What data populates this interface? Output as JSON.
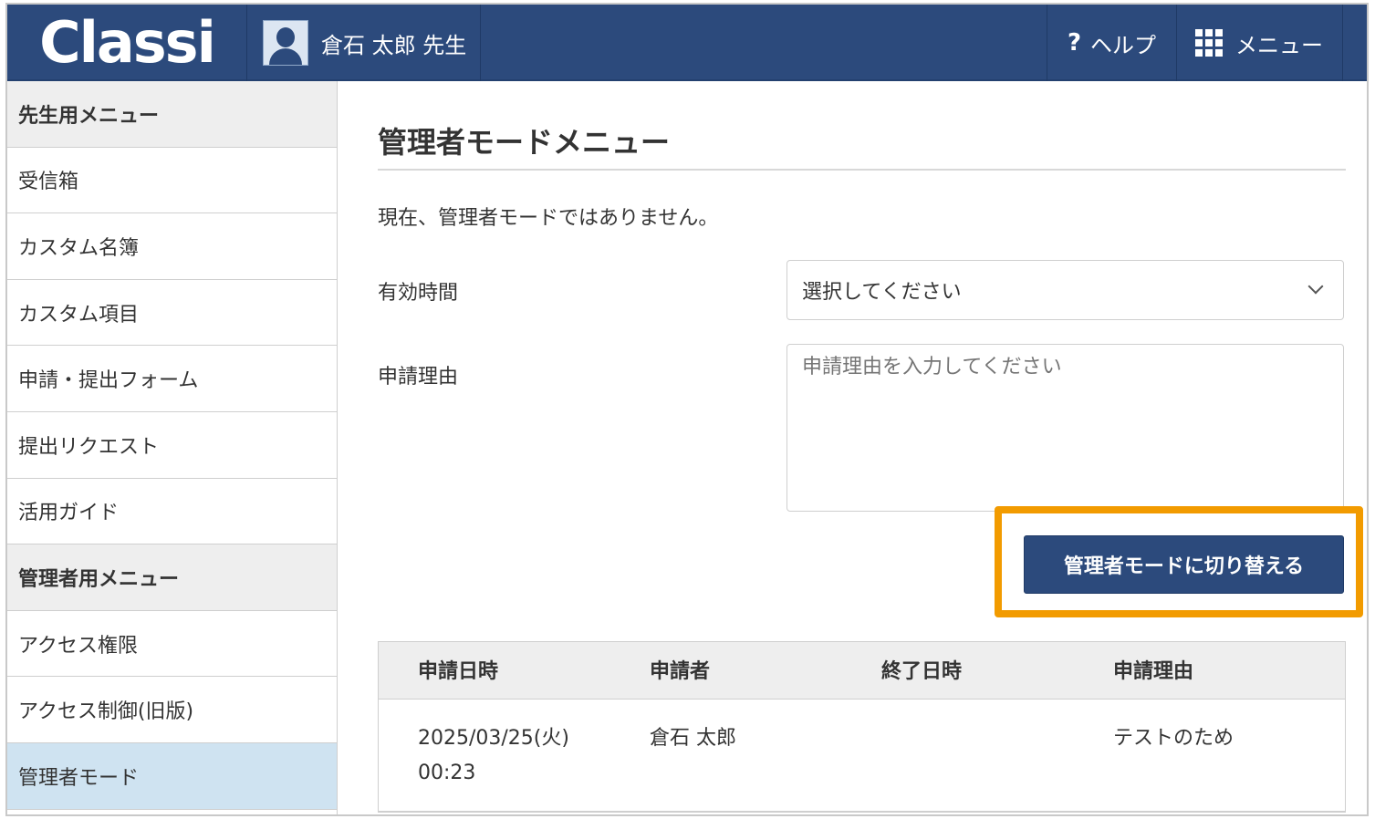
{
  "header": {
    "logo_text": "Classi",
    "user_name": "倉石 太郎 先生",
    "help_label": "ヘルプ",
    "menu_label": "メニュー",
    "brand_color": "#2c4a7c"
  },
  "sidebar": {
    "items": [
      {
        "label": "先生用メニュー",
        "type": "heading"
      },
      {
        "label": "受信箱",
        "type": "link"
      },
      {
        "label": "カスタム名簿",
        "type": "link"
      },
      {
        "label": "カスタム項目",
        "type": "link"
      },
      {
        "label": "申請・提出フォーム",
        "type": "link"
      },
      {
        "label": "提出リクエスト",
        "type": "link"
      },
      {
        "label": "活用ガイド",
        "type": "link"
      },
      {
        "label": "管理者用メニュー",
        "type": "heading"
      },
      {
        "label": "アクセス権限",
        "type": "link"
      },
      {
        "label": "アクセス制御(旧版)",
        "type": "link"
      },
      {
        "label": "管理者モード",
        "type": "link",
        "active": true
      }
    ]
  },
  "main": {
    "title": "管理者モードメニュー",
    "status": "現在、管理者モードではありません。",
    "duration_label": "有効時間",
    "duration_value": "選択してください",
    "reason_label": "申請理由",
    "reason_placeholder": "申請理由を入力してください",
    "switch_button": "管理者モードに切り替える",
    "highlight_color": "#f29b00"
  },
  "table": {
    "headers": [
      "申請日時",
      "申請者",
      "終了日時",
      "申請理由"
    ],
    "rows": [
      {
        "date_line1": "2025/03/25(火)",
        "date_line2": "00:23",
        "applicant": "倉石 太郎",
        "end": "",
        "reason": "テストのため"
      }
    ]
  }
}
